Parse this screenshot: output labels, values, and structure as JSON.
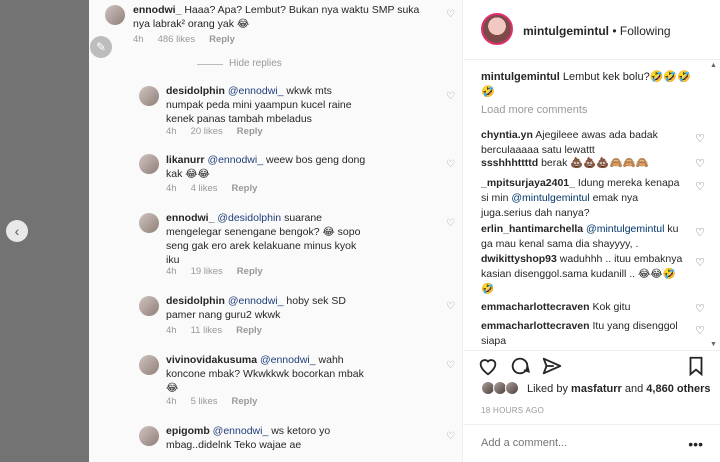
{
  "media": {
    "comments": [
      {
        "user": "ennodwi_",
        "text": "Haaa? Apa? Lembut? Bukan nya waktu SMP suka nya labrak² orang yak 😂",
        "time": "4h",
        "likes": "486 likes",
        "reply": "Reply"
      },
      {
        "user": "desidolphin",
        "mention": "@ennodwi_",
        "text": "wkwk mts numpak peda mini yaampun kucel raine kenek panas tambah mbeladus",
        "time": "4h",
        "likes": "20 likes",
        "reply": "Reply"
      },
      {
        "user": "likanurr",
        "mention": "@ennodwi_",
        "text": "weew bos geng dong kak 😂😂",
        "time": "4h",
        "likes": "4 likes",
        "reply": "Reply"
      },
      {
        "user": "ennodwi_",
        "mention": "@desidolphin",
        "text": "suarane mengelegar senengane bengok? 😂 sopo seng gak ero arek kelakuane minus kyok iku",
        "time": "4h",
        "likes": "19 likes",
        "reply": "Reply"
      },
      {
        "user": "desidolphin",
        "mention": "@ennodwi_",
        "text": "hoby sek SD pamer nang guru2 wkwk",
        "time": "4h",
        "likes": "11 likes",
        "reply": "Reply"
      },
      {
        "user": "vivinovidakusuma",
        "mention": "@ennodwi_",
        "text": "wahh koncone mbak? Wkwkkwk bocorkan mbak 😂",
        "time": "4h",
        "likes": "5 likes",
        "reply": "Reply"
      },
      {
        "user": "epigomb",
        "mention": "@ennodwi_",
        "text": "ws ketoro yo mbag..didelnk Teko wajae ae",
        "time": "",
        "likes": "",
        "reply": ""
      }
    ],
    "hide_replies": "Hide replies"
  },
  "panel": {
    "username": "mintulgemintul",
    "follow_status": "Following",
    "caption_user": "mintulgemintul",
    "caption_text": "Lembut kek bolu?🤣🤣🤣🤣",
    "load_more": "Load more comments",
    "comments": [
      {
        "user": "chyntia.yn",
        "text": "Ajegileee awas ada badak berculaaaaa satu lewattt"
      },
      {
        "user": "ssshhhttttd",
        "text": "berak 💩💩💩🙈🙈🙈"
      },
      {
        "user": "_mpitsurjaya2401_",
        "text": "Idung mereka kenapa si min",
        "mention": "@mintulgemintul",
        "text2": "emak nya juga.serius dah nanya?"
      },
      {
        "user": "erlin_hantimarchella",
        "mention": "@mintulgemintul",
        "text": "ku ga mau kenal sama dia shayyyy, ."
      },
      {
        "user": "dwikittyshop93",
        "text": "waduhhh .. ituu embaknya kasian disenggol.sama kudanill .. 😂😂🤣🤣"
      },
      {
        "user": "emmacharlottecraven",
        "text": "Kok gitu"
      },
      {
        "user": "emmacharlottecraven",
        "text": "Itu yang disenggol siapa"
      }
    ],
    "likes_user": "masfaturr",
    "likes_text_prefix": "Liked by",
    "likes_text_mid": "and",
    "likes_others": "4,860 others",
    "time": "18 HOURS AGO",
    "add_comment_placeholder": "Add a comment..."
  },
  "colors": {
    "link": "#003569",
    "muted": "#999999",
    "story_ring": "#e1306c"
  }
}
